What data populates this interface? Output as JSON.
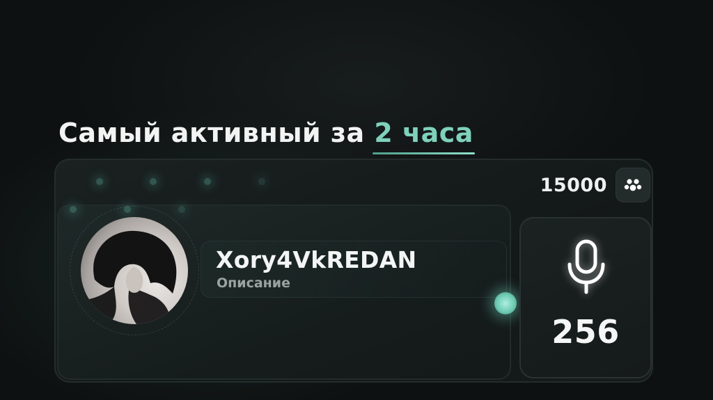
{
  "heading": {
    "prefix": "Самый активный за ",
    "accent": "2 часа"
  },
  "members": {
    "count": "15000",
    "icon": "group-icon"
  },
  "profile": {
    "username": "Xory4VkREDAN",
    "description": "Описание",
    "avatar": "user-avatar"
  },
  "voice": {
    "icon": "microphone-icon",
    "count": "256"
  },
  "colors": {
    "accent": "#7fd1bb",
    "background": "#0e1111",
    "card": "#161c1b"
  }
}
